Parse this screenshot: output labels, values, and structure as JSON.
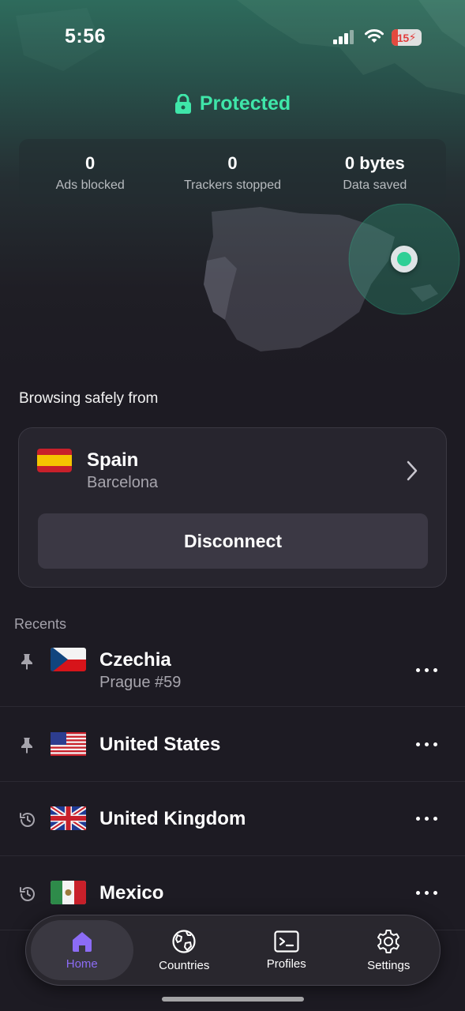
{
  "status_bar": {
    "time": "5:56",
    "battery": "15"
  },
  "protection": {
    "status": "Protected",
    "accent_color": "#3fe6a9",
    "icon": "lock-icon"
  },
  "stats": [
    {
      "value": "0",
      "label": "Ads blocked"
    },
    {
      "value": "0",
      "label": "Trackers stopped"
    },
    {
      "value": "0 bytes",
      "label": "Data saved"
    }
  ],
  "browsing_label": "Browsing safely from",
  "connection": {
    "country": "Spain",
    "city": "Barcelona",
    "flag": "spain-flag-icon",
    "disconnect_label": "Disconnect"
  },
  "recents": {
    "title": "Recents",
    "items": [
      {
        "country": "Czechia",
        "server": "Prague #59",
        "lead_icon": "pin-icon",
        "flag": "czechia-flag-icon"
      },
      {
        "country": "United States",
        "lead_icon": "pin-icon",
        "flag": "usa-flag-icon"
      },
      {
        "country": "United Kingdom",
        "lead_icon": "history-icon",
        "flag": "uk-flag-icon"
      },
      {
        "country": "Mexico",
        "lead_icon": "history-icon",
        "flag": "mexico-flag-icon"
      }
    ]
  },
  "tabs": [
    {
      "label": "Home",
      "icon": "home-icon",
      "active": true
    },
    {
      "label": "Countries",
      "icon": "globe-icon"
    },
    {
      "label": "Profiles",
      "icon": "terminal-icon"
    },
    {
      "label": "Settings",
      "icon": "gear-icon"
    }
  ],
  "colors": {
    "active_tab": "#8c6cf5",
    "background": "#1d1b23"
  }
}
